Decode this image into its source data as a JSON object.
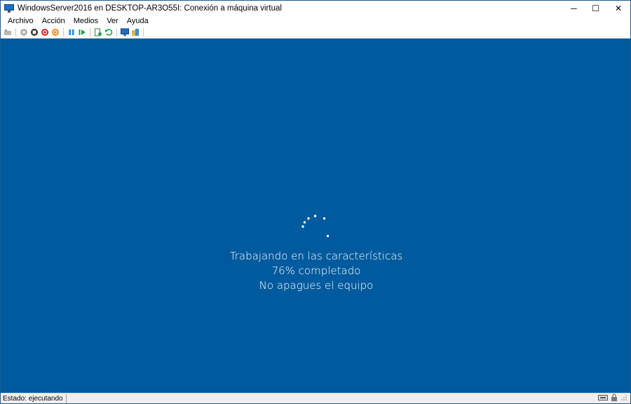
{
  "window": {
    "title": "WindowsServer2016 en DESKTOP-AR3O55I: Conexión a máquina virtual",
    "controls": {
      "minimize": "─",
      "maximize": "☐",
      "close": "✕"
    }
  },
  "menu": [
    "Archivo",
    "Acción",
    "Medios",
    "Ver",
    "Ayuda"
  ],
  "toolbar": {
    "buttons": [
      "ctrl-alt-del-icon",
      "start-icon",
      "turn-off-icon",
      "shutdown-icon",
      "save-state-icon",
      "pause-icon",
      "resume-icon",
      "checkpoint-icon",
      "revert-icon",
      "enhanced-session-icon",
      "share-icon"
    ]
  },
  "screen": {
    "background": "#005a9e",
    "line1": "Trabajando en las características",
    "line2": "76% completado",
    "line3": "No apagues el equipo",
    "progress_percent": 76
  },
  "statusbar": {
    "state": "Estado: ejecutando"
  }
}
